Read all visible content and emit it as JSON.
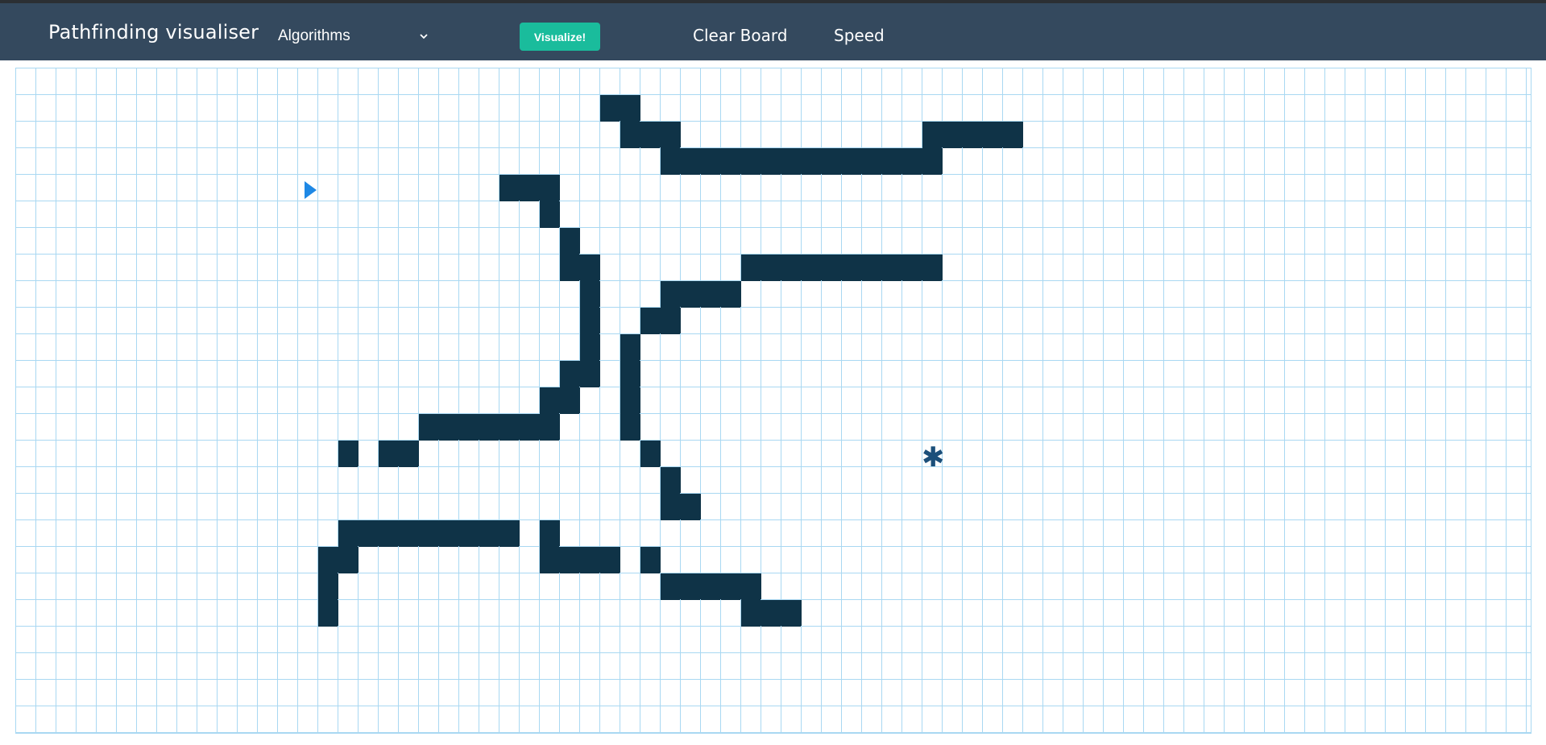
{
  "navbar": {
    "brand": "Pathfinding visualiser",
    "algorithms_label": "Algorithms",
    "visualize_label": "Visualize!",
    "clear_board_label": "Clear Board",
    "speed_label": "Speed",
    "background_color": "#34495e",
    "visualize_color": "#1abc9c"
  },
  "icons": {
    "dropdown": "chevron-down-icon",
    "start": "start-node-triangle-icon",
    "target": "target-node-asterisk-icon",
    "target_glyph": "✱"
  },
  "grid": {
    "columns": 75,
    "rows": 25,
    "line_color": "#a9d8f2",
    "wall_color": "#0f3347",
    "start": [
      14,
      4
    ],
    "target": [
      45,
      14
    ],
    "walls": [
      [
        29,
        1
      ],
      [
        30,
        1
      ],
      [
        30,
        2
      ],
      [
        31,
        2
      ],
      [
        32,
        2
      ],
      [
        45,
        2
      ],
      [
        46,
        2
      ],
      [
        47,
        2
      ],
      [
        48,
        2
      ],
      [
        49,
        2
      ],
      [
        32,
        3
      ],
      [
        33,
        3
      ],
      [
        34,
        3
      ],
      [
        35,
        3
      ],
      [
        36,
        3
      ],
      [
        37,
        3
      ],
      [
        38,
        3
      ],
      [
        39,
        3
      ],
      [
        40,
        3
      ],
      [
        41,
        3
      ],
      [
        42,
        3
      ],
      [
        43,
        3
      ],
      [
        44,
        3
      ],
      [
        45,
        3
      ],
      [
        24,
        4
      ],
      [
        25,
        4
      ],
      [
        26,
        4
      ],
      [
        26,
        5
      ],
      [
        27,
        6
      ],
      [
        27,
        7
      ],
      [
        28,
        7
      ],
      [
        36,
        7
      ],
      [
        37,
        7
      ],
      [
        38,
        7
      ],
      [
        39,
        7
      ],
      [
        40,
        7
      ],
      [
        41,
        7
      ],
      [
        42,
        7
      ],
      [
        43,
        7
      ],
      [
        44,
        7
      ],
      [
        45,
        7
      ],
      [
        28,
        8
      ],
      [
        32,
        8
      ],
      [
        33,
        8
      ],
      [
        34,
        8
      ],
      [
        35,
        8
      ],
      [
        28,
        9
      ],
      [
        31,
        9
      ],
      [
        32,
        9
      ],
      [
        28,
        10
      ],
      [
        30,
        10
      ],
      [
        27,
        11
      ],
      [
        28,
        11
      ],
      [
        30,
        11
      ],
      [
        26,
        12
      ],
      [
        27,
        12
      ],
      [
        30,
        12
      ],
      [
        20,
        13
      ],
      [
        21,
        13
      ],
      [
        22,
        13
      ],
      [
        23,
        13
      ],
      [
        24,
        13
      ],
      [
        25,
        13
      ],
      [
        26,
        13
      ],
      [
        30,
        13
      ],
      [
        16,
        14
      ],
      [
        18,
        14
      ],
      [
        19,
        14
      ],
      [
        31,
        14
      ],
      [
        32,
        15
      ],
      [
        32,
        16
      ],
      [
        33,
        16
      ],
      [
        16,
        17
      ],
      [
        17,
        17
      ],
      [
        18,
        17
      ],
      [
        19,
        17
      ],
      [
        20,
        17
      ],
      [
        21,
        17
      ],
      [
        22,
        17
      ],
      [
        23,
        17
      ],
      [
        24,
        17
      ],
      [
        26,
        17
      ],
      [
        15,
        18
      ],
      [
        16,
        18
      ],
      [
        26,
        18
      ],
      [
        27,
        18
      ],
      [
        28,
        18
      ],
      [
        29,
        18
      ],
      [
        31,
        18
      ],
      [
        15,
        19
      ],
      [
        32,
        19
      ],
      [
        33,
        19
      ],
      [
        34,
        19
      ],
      [
        35,
        19
      ],
      [
        36,
        19
      ],
      [
        15,
        20
      ],
      [
        36,
        20
      ],
      [
        37,
        20
      ],
      [
        38,
        20
      ]
    ]
  }
}
